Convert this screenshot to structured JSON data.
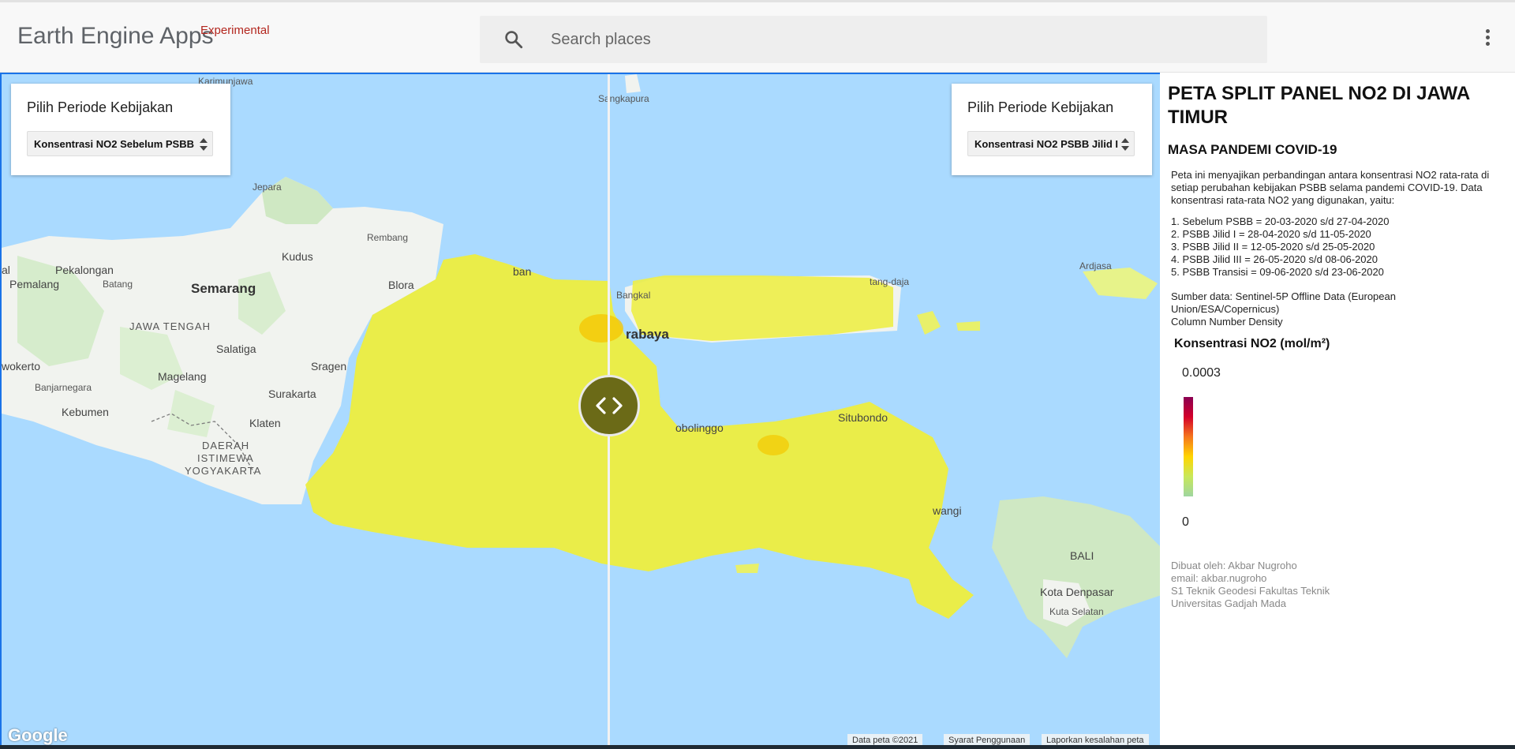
{
  "header": {
    "app_name": "Earth Engine Apps",
    "app_tag": "Experimental",
    "search_placeholder": "Search places"
  },
  "map": {
    "left_panel": {
      "title": "Pilih Periode Kebijakan",
      "selected": "Konsentrasi NO2 Sebelum PSBB"
    },
    "right_panel": {
      "title": "Pilih Periode Kebijakan",
      "selected": "Konsentrasi NO2 PSBB Jilid I"
    },
    "place_labels": {
      "karimunjawa": "Karimunjawa",
      "sangkapura": "Sangkapura",
      "jepara": "Jepara",
      "rembang": "Rembang",
      "kudus": "Kudus",
      "pekalongan": "Pekalongan",
      "batang": "Batang",
      "pemalang": "Pemalang",
      "semarang": "Semarang",
      "blora": "Blora",
      "tuban": "ban",
      "bangkalan": "Bangkal",
      "sumenep": "tang-daja",
      "ardjasa": "Ardjasa",
      "jawa_tengah": "JAWA TENGAH",
      "salatiga": "Salatiga",
      "surabaya": "rabaya",
      "purwokerto": "wokerto",
      "sragen": "Sragen",
      "magelang": "Magelang",
      "banjarnegara": "Banjarnegara",
      "surakarta": "Surakarta",
      "kebumen": "Kebumen",
      "klaten": "Klaten",
      "probolinggo": "obolinggo",
      "situbondo": "Situbondo",
      "diy_1": "DAERAH",
      "diy_2": "ISTIMEWA",
      "diy_3": "YOGYAKARTA",
      "banyuwangi": "wangi",
      "bali": "BALI",
      "denpasar": "Kota Denpasar",
      "kuta": "Kuta Selatan",
      "left_edge": "al"
    },
    "google": "Google",
    "attribution": {
      "data": "Data peta ©2021",
      "terms": "Syarat Penggunaan",
      "report": "Laporkan kesalahan peta"
    }
  },
  "side_panel": {
    "title": "PETA SPLIT PANEL NO2 DI JAWA TIMUR",
    "subtitle": "MASA PANDEMI COVID-19",
    "description": "Peta ini menyajikan perbandingan antara konsentrasi NO2 rata-rata di setiap perubahan kebijakan PSBB selama pandemi COVID-19. Data konsentrasi rata-rata NO2 yang digunakan, yaitu:",
    "periods": [
      "1. Sebelum PSBB = 20-03-2020 s/d 27-04-2020",
      "2. PSBB Jilid I = 28-04-2020 s/d 11-05-2020",
      "3. PSBB Jilid II = 12-05-2020 s/d 25-05-2020",
      "4. PSBB Jilid III = 26-05-2020 s/d 08-06-2020",
      "5. PSBB Transisi = 09-06-2020 s/d 23-06-2020"
    ],
    "source_1": "Sumber data: Sentinel-5P Offline Data (European Union/ESA/Copernicus)",
    "source_2": "Column Number Density",
    "legend": {
      "title": "Konsentrasi NO2 (mol/m²)",
      "max": "0.0003",
      "min": "0",
      "colors": [
        "#8a0052",
        "#d4002a",
        "#f5761c",
        "#ffd500",
        "#c8e85a",
        "#9fd6a0"
      ]
    },
    "credits": [
      "Dibuat oleh: Akbar Nugroho",
      "email: akbar.nugroho",
      "S1 Teknik Geodesi Fakultas Teknik",
      "Universitas Gadjah Mada"
    ]
  }
}
